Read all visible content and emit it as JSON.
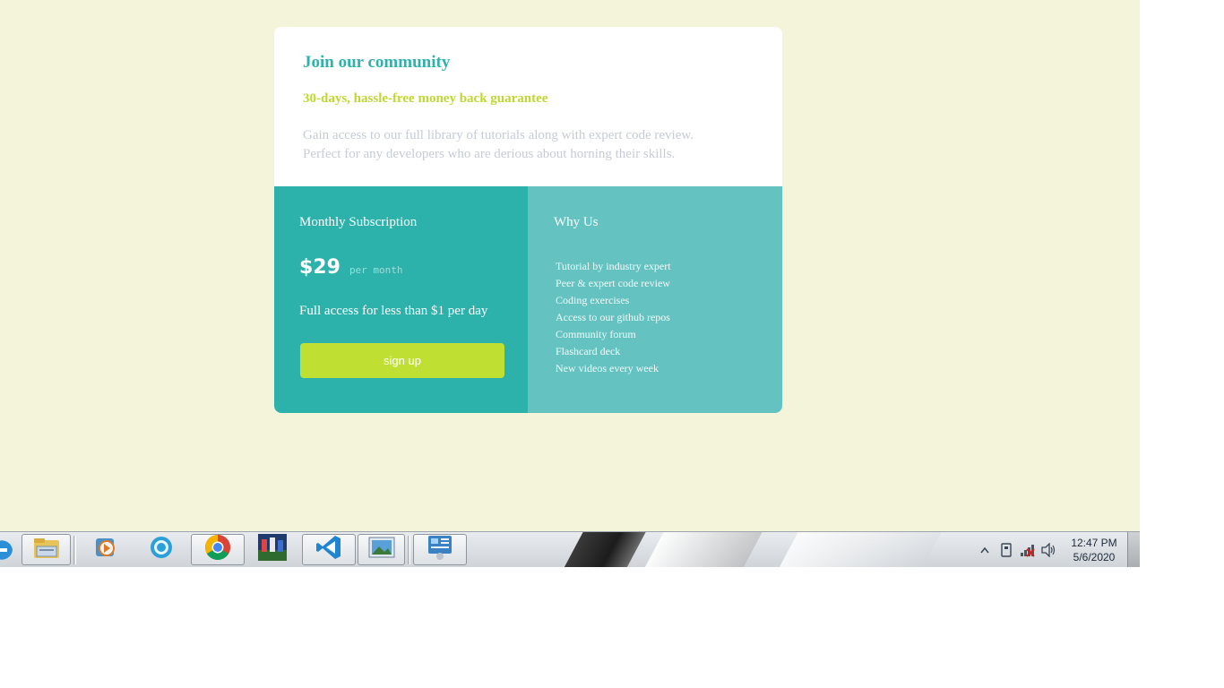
{
  "card": {
    "title": "Join our community",
    "guarantee": "30-days, hassle-free money back guarantee",
    "description_line1": "Gain access to our full library of tutorials along with expert code review.",
    "description_line2": "Perfect for any developers who are derious about horning their skills."
  },
  "subscription": {
    "title": "Monthly Subscription",
    "price": "$29",
    "per": "per month",
    "tagline": "Full access for less than $1 per day",
    "button_label": "sign up"
  },
  "why_us": {
    "title": "Why Us",
    "items": [
      "Tutorial by industry expert",
      "Peer & expert code review",
      "Coding exercises",
      "Access to our github repos",
      "Community forum",
      "Flashcard deck",
      "New videos every week"
    ]
  },
  "taskbar": {
    "apps": [
      {
        "name": "internet-explorer-icon"
      },
      {
        "name": "file-explorer-icon"
      },
      {
        "name": "media-player-icon"
      },
      {
        "name": "bluetooth-app-icon"
      },
      {
        "name": "chrome-icon"
      },
      {
        "name": "pes-game-icon"
      },
      {
        "name": "vscode-icon"
      },
      {
        "name": "photo-viewer-icon"
      },
      {
        "name": "control-panel-icon"
      }
    ],
    "clock": {
      "time": "12:47 PM",
      "date": "5/6/2020"
    }
  },
  "colors": {
    "background": "#f3f4da",
    "teal": "#2cb1ab",
    "teal_light": "#64c3c1",
    "lime": "#bfe033",
    "title": "#2db2ad",
    "guarantee": "#bfd82f",
    "muted_text": "#c6cbd6"
  }
}
